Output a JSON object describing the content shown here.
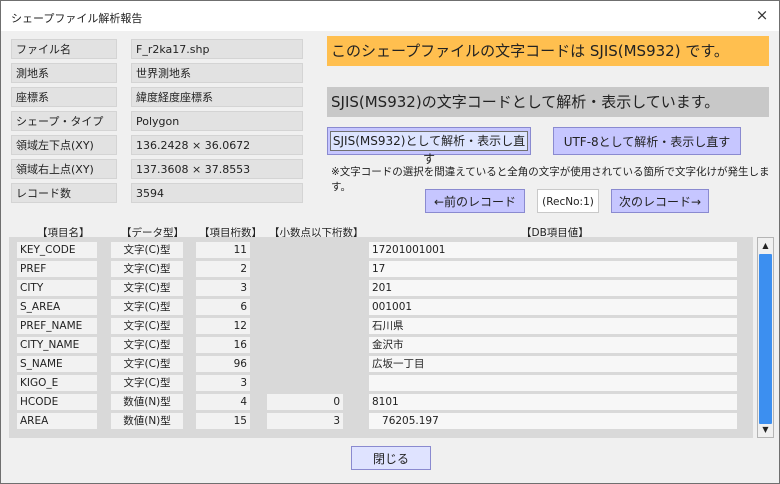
{
  "window": {
    "title": "シェープファイル解析報告",
    "close_glyph": "×"
  },
  "props": [
    {
      "label": "ファイル名",
      "value": "F_r2ka17.shp"
    },
    {
      "label": "測地系",
      "value": "世界測地系"
    },
    {
      "label": "座標系",
      "value": "緯度経度座標系"
    },
    {
      "label": "シェープ・タイプ",
      "value": "Polygon"
    },
    {
      "label": "領域左下点(XY)",
      "value": "136.2428 × 36.0672"
    },
    {
      "label": "領域右上点(XY)",
      "value": "137.3608 × 37.8553"
    },
    {
      "label": "レコード数",
      "value": "3594"
    }
  ],
  "banner1": {
    "text": "このシェープファイルの文字コードは SJIS(MS932) です。",
    "color": "#ffbf4f"
  },
  "banner2": {
    "text": "SJIS(MS932)の文字コードとして解析・表示しています。",
    "color": "#c8c8c8"
  },
  "buttons": {
    "sjis": "SJIS(MS932)として解析・表示し直す",
    "utf8": "UTF-8として解析・表示し直す",
    "prev": "←前のレコード",
    "next": "次のレコード→",
    "close": "閉じる",
    "accent": "#c6c6ff"
  },
  "note": "※文字コードの選択を間違えていると全角の文字が使用されている箇所で文字化けが発生します。",
  "recno": "(RecNo:1)",
  "columns": {
    "name": "【項目名】",
    "type": "【データ型】",
    "len": "【項目桁数】",
    "dec": "【小数点以下桁数】",
    "value": "【DB項目値】"
  },
  "rows": [
    {
      "name": "KEY_CODE",
      "type": "文字(C)型",
      "len": "11",
      "dec": "",
      "value": "17201001001"
    },
    {
      "name": "PREF",
      "type": "文字(C)型",
      "len": "2",
      "dec": "",
      "value": "17"
    },
    {
      "name": "CITY",
      "type": "文字(C)型",
      "len": "3",
      "dec": "",
      "value": "201"
    },
    {
      "name": "S_AREA",
      "type": "文字(C)型",
      "len": "6",
      "dec": "",
      "value": "001001"
    },
    {
      "name": "PREF_NAME",
      "type": "文字(C)型",
      "len": "12",
      "dec": "",
      "value": "石川県"
    },
    {
      "name": "CITY_NAME",
      "type": "文字(C)型",
      "len": "16",
      "dec": "",
      "value": "金沢市"
    },
    {
      "name": "S_NAME",
      "type": "文字(C)型",
      "len": "96",
      "dec": "",
      "value": "広坂一丁目"
    },
    {
      "name": "KIGO_E",
      "type": "文字(C)型",
      "len": "3",
      "dec": "",
      "value": ""
    },
    {
      "name": "HCODE",
      "type": "数値(N)型",
      "len": "4",
      "dec": "0",
      "value": "8101"
    },
    {
      "name": "AREA",
      "type": "数値(N)型",
      "len": "15",
      "dec": "3",
      "value": "   76205.197"
    }
  ]
}
